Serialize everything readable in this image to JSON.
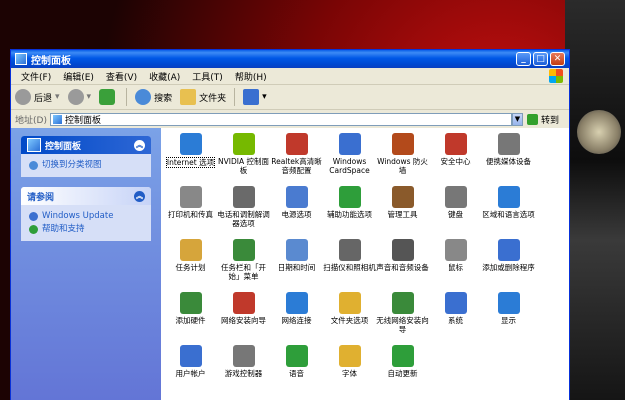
{
  "window": {
    "title": "控制面板"
  },
  "menu": [
    "文件(F)",
    "编辑(E)",
    "查看(V)",
    "收藏(A)",
    "工具(T)",
    "帮助(H)"
  ],
  "toolbar": {
    "back": "后退",
    "search": "搜索",
    "folders": "文件夹"
  },
  "address": {
    "label": "地址(D)",
    "value": "控制面板",
    "go": "转到"
  },
  "sidebar": {
    "panel1": {
      "title": "控制面板",
      "link": "切换到分类视图"
    },
    "panel2": {
      "title": "请参阅",
      "links": [
        "Windows Update",
        "帮助和支持"
      ]
    }
  },
  "icons": [
    {
      "label": "Internet 选项",
      "icon": "globe-icon",
      "color": "#2b7cd6"
    },
    {
      "label": "NVIDIA 控制面板",
      "icon": "nvidia-icon",
      "color": "#76b900"
    },
    {
      "label": "Realtek高清晰音频配置",
      "icon": "speaker-icon",
      "color": "#c0392b"
    },
    {
      "label": "Windows CardSpace",
      "icon": "cardspace-icon",
      "color": "#3a6fd0"
    },
    {
      "label": "Windows 防火墙",
      "icon": "firewall-icon",
      "color": "#b34a1b"
    },
    {
      "label": "安全中心",
      "icon": "shield-icon",
      "color": "#c0392b"
    },
    {
      "label": "便携媒体设备",
      "icon": "media-device-icon",
      "color": "#777"
    },
    {
      "label": "打印机和传真",
      "icon": "printer-icon",
      "color": "#888"
    },
    {
      "label": "电话和调制解调器选项",
      "icon": "phone-icon",
      "color": "#6a6a6a"
    },
    {
      "label": "电源选项",
      "icon": "power-icon",
      "color": "#4a7bd0"
    },
    {
      "label": "辅助功能选项",
      "icon": "accessibility-icon",
      "color": "#2e9e3a"
    },
    {
      "label": "管理工具",
      "icon": "admin-tools-icon",
      "color": "#8a5a2b"
    },
    {
      "label": "键盘",
      "icon": "keyboard-icon",
      "color": "#777"
    },
    {
      "label": "区域和语言选项",
      "icon": "globe-language-icon",
      "color": "#2b7cd6"
    },
    {
      "label": "任务计划",
      "icon": "scheduled-tasks-icon",
      "color": "#d6a53b"
    },
    {
      "label": "任务栏和「开始」菜单",
      "icon": "taskbar-icon",
      "color": "#3a8a3a"
    },
    {
      "label": "日期和时间",
      "icon": "clock-icon",
      "color": "#5a8ad0"
    },
    {
      "label": "扫描仪和照相机",
      "icon": "scanner-icon",
      "color": "#666"
    },
    {
      "label": "声音和音频设备",
      "icon": "sound-icon",
      "color": "#555"
    },
    {
      "label": "鼠标",
      "icon": "mouse-icon",
      "color": "#888"
    },
    {
      "label": "添加或删除程序",
      "icon": "add-remove-icon",
      "color": "#3a6fd0"
    },
    {
      "label": "添加硬件",
      "icon": "add-hardware-icon",
      "color": "#3a8a3a"
    },
    {
      "label": "网络安装向导",
      "icon": "network-wizard-icon",
      "color": "#c0392b"
    },
    {
      "label": "网络连接",
      "icon": "network-icon",
      "color": "#2b7cd6"
    },
    {
      "label": "文件夹选项",
      "icon": "folder-options-icon",
      "color": "#e0b030"
    },
    {
      "label": "无线网络安装向导",
      "icon": "wireless-icon",
      "color": "#3a8a3a"
    },
    {
      "label": "系统",
      "icon": "system-icon",
      "color": "#3a6fd0"
    },
    {
      "label": "显示",
      "icon": "display-icon",
      "color": "#2b7cd6"
    },
    {
      "label": "用户帐户",
      "icon": "user-accounts-icon",
      "color": "#3a6fd0"
    },
    {
      "label": "游戏控制器",
      "icon": "game-controller-icon",
      "color": "#777"
    },
    {
      "label": "语音",
      "icon": "speech-icon",
      "color": "#2e9e3a"
    },
    {
      "label": "字体",
      "icon": "fonts-icon",
      "color": "#e0b030"
    },
    {
      "label": "自动更新",
      "icon": "auto-update-icon",
      "color": "#2e9e3a"
    }
  ]
}
